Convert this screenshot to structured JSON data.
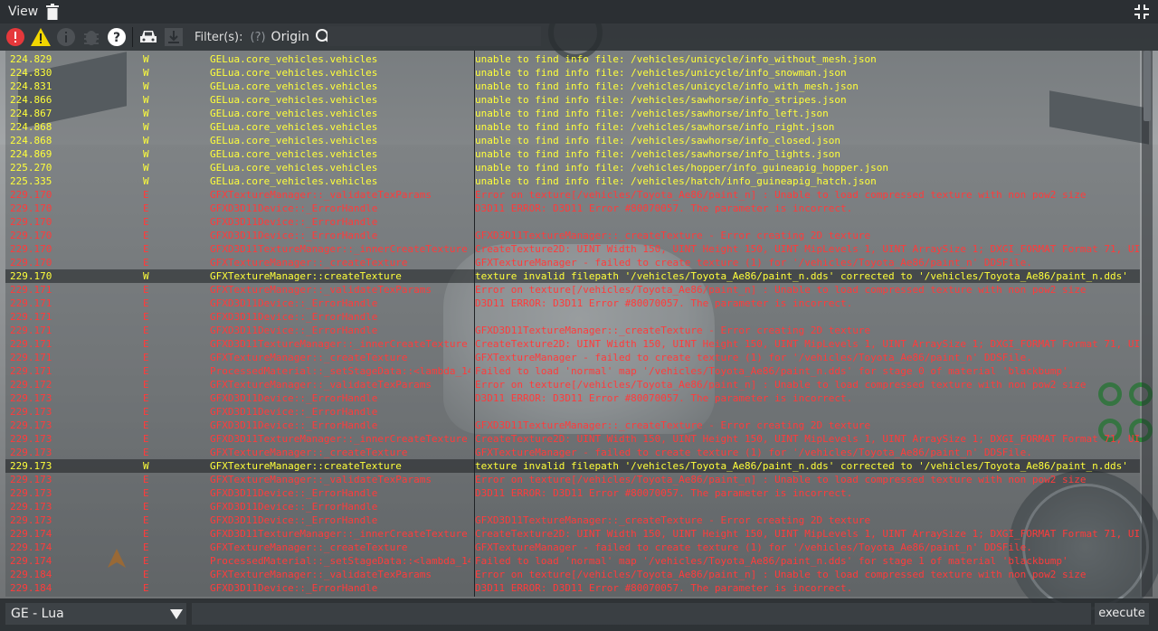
{
  "window": {
    "title": "View"
  },
  "toolbar": {
    "filter_label": "Filter(s):",
    "filter_help": "(?)",
    "origin_label": "Origin",
    "search_value": "",
    "colors": {
      "error": "#e5383b",
      "warning": "#f2d600",
      "help": "#ffffff"
    },
    "icons": [
      "error-filter-icon",
      "warning-filter-icon",
      "info-filter-icon",
      "debug-filter-icon",
      "help-icon",
      "vehicle-filter-icon",
      "download-icon"
    ]
  },
  "log": [
    {
      "time": "224.829",
      "level": "W",
      "origin": "GELua.core_vehicles.vehicles",
      "message": "unable to find info file: /vehicles/unicycle/info_without_mesh.json"
    },
    {
      "time": "224.830",
      "level": "W",
      "origin": "GELua.core_vehicles.vehicles",
      "message": "unable to find info file: /vehicles/unicycle/info_snowman.json"
    },
    {
      "time": "224.831",
      "level": "W",
      "origin": "GELua.core_vehicles.vehicles",
      "message": "unable to find info file: /vehicles/unicycle/info_with_mesh.json"
    },
    {
      "time": "224.866",
      "level": "W",
      "origin": "GELua.core_vehicles.vehicles",
      "message": "unable to find info file: /vehicles/sawhorse/info_stripes.json"
    },
    {
      "time": "224.867",
      "level": "W",
      "origin": "GELua.core_vehicles.vehicles",
      "message": "unable to find info file: /vehicles/sawhorse/info_left.json"
    },
    {
      "time": "224.868",
      "level": "W",
      "origin": "GELua.core_vehicles.vehicles",
      "message": "unable to find info file: /vehicles/sawhorse/info_right.json"
    },
    {
      "time": "224.868",
      "level": "W",
      "origin": "GELua.core_vehicles.vehicles",
      "message": "unable to find info file: /vehicles/sawhorse/info_closed.json"
    },
    {
      "time": "224.869",
      "level": "W",
      "origin": "GELua.core_vehicles.vehicles",
      "message": "unable to find info file: /vehicles/sawhorse/info_lights.json"
    },
    {
      "time": "225.270",
      "level": "W",
      "origin": "GELua.core_vehicles.vehicles",
      "message": "unable to find info file: /vehicles/hopper/info_guineapig_hopper.json"
    },
    {
      "time": "225.335",
      "level": "W",
      "origin": "GELua.core_vehicles.vehicles",
      "message": "unable to find info file: /vehicles/hatch/info_guineapig_hatch.json"
    },
    {
      "time": "229.170",
      "level": "E",
      "origin": "GFXTextureManager::_validateTexParams",
      "message": "Error on texture[/vehicles/Toyota_Ae86/paint_n] : Unable to load compressed texture with non pow2 size"
    },
    {
      "time": "229.170",
      "level": "E",
      "origin": "GFXD3D11Device::_ErrorHandle",
      "message": "D3D11 ERROR: D3D11 Error #80070057. The parameter is incorrect."
    },
    {
      "time": "229.170",
      "level": "E",
      "origin": "GFXD3D11Device::_ErrorHandle",
      "message": ""
    },
    {
      "time": "229.170",
      "level": "E",
      "origin": "GFXD3D11Device::_ErrorHandle",
      "message": "GFXD3D11TextureManager::_createTexture - Error creating 2D texture"
    },
    {
      "time": "229.170",
      "level": "E",
      "origin": "GFXD3D11TextureManager::_innerCreateTexture",
      "message": "CreateTexture2D: UINT Width 150, UINT Height 150, UINT MipLevels 1, UINT ArraySize 1; DXGI_FORMAT Format 71, UIN"
    },
    {
      "time": "229.170",
      "level": "E",
      "origin": "GFXTextureManager::_createTexture",
      "message": "GFXTextureManager - failed to create texture (1) for '/vehicles/Toyota_Ae86/paint_n' DDSFile."
    },
    {
      "time": "229.170",
      "level": "W",
      "origin": "GFXTextureManager::createTexture",
      "message": "texture invalid filepath '/vehicles/Toyota_Ae86/paint_n.dds' corrected to '/vehicles/Toyota_Ae86/paint_n.dds'"
    },
    {
      "time": "229.171",
      "level": "E",
      "origin": "GFXTextureManager::_validateTexParams",
      "message": "Error on texture[/vehicles/Toyota_Ae86/paint_n] : Unable to load compressed texture with non pow2 size"
    },
    {
      "time": "229.171",
      "level": "E",
      "origin": "GFXD3D11Device::_ErrorHandle",
      "message": "D3D11 ERROR: D3D11 Error #80070057. The parameter is incorrect."
    },
    {
      "time": "229.171",
      "level": "E",
      "origin": "GFXD3D11Device::_ErrorHandle",
      "message": ""
    },
    {
      "time": "229.171",
      "level": "E",
      "origin": "GFXD3D11Device::_ErrorHandle",
      "message": "GFXD3D11TextureManager::_createTexture - Error creating 2D texture"
    },
    {
      "time": "229.171",
      "level": "E",
      "origin": "GFXD3D11TextureManager::_innerCreateTexture",
      "message": "CreateTexture2D: UINT Width 150, UINT Height 150, UINT MipLevels 1, UINT ArraySize 1; DXGI_FORMAT Format 71, UIN"
    },
    {
      "time": "229.171",
      "level": "E",
      "origin": "GFXTextureManager::_createTexture",
      "message": "GFXTextureManager - failed to create texture (1) for '/vehicles/Toyota_Ae86/paint_n' DDSFile."
    },
    {
      "time": "229.171",
      "level": "E",
      "origin": "ProcessedMaterial::_setStageData::<lambda_14",
      "message": "Failed to load 'normal' map '/vehicles/Toyota_Ae86/paint_n.dds' for stage 0 of material 'blackbump'"
    },
    {
      "time": "229.172",
      "level": "E",
      "origin": "GFXTextureManager::_validateTexParams",
      "message": "Error on texture[/vehicles/Toyota_Ae86/paint_n] : Unable to load compressed texture with non pow2 size"
    },
    {
      "time": "229.173",
      "level": "E",
      "origin": "GFXD3D11Device::_ErrorHandle",
      "message": "D3D11 ERROR: D3D11 Error #80070057. The parameter is incorrect."
    },
    {
      "time": "229.173",
      "level": "E",
      "origin": "GFXD3D11Device::_ErrorHandle",
      "message": ""
    },
    {
      "time": "229.173",
      "level": "E",
      "origin": "GFXD3D11Device::_ErrorHandle",
      "message": "GFXD3D11TextureManager::_createTexture - Error creating 2D texture"
    },
    {
      "time": "229.173",
      "level": "E",
      "origin": "GFXD3D11TextureManager::_innerCreateTexture",
      "message": "CreateTexture2D: UINT Width 150, UINT Height 150, UINT MipLevels 1, UINT ArraySize 1; DXGI_FORMAT Format 71, UIN"
    },
    {
      "time": "229.173",
      "level": "E",
      "origin": "GFXTextureManager::_createTexture",
      "message": "GFXTextureManager - failed to create texture (1) for '/vehicles/Toyota_Ae86/paint_n' DDSFile."
    },
    {
      "time": "229.173",
      "level": "W",
      "origin": "GFXTextureManager::createTexture",
      "message": "texture invalid filepath '/vehicles/Toyota_Ae86/paint_n.dds' corrected to '/vehicles/Toyota_Ae86/paint_n.dds'"
    },
    {
      "time": "229.173",
      "level": "E",
      "origin": "GFXTextureManager::_validateTexParams",
      "message": "Error on texture[/vehicles/Toyota_Ae86/paint_n] : Unable to load compressed texture with non pow2 size"
    },
    {
      "time": "229.173",
      "level": "E",
      "origin": "GFXD3D11Device::_ErrorHandle",
      "message": "D3D11 ERROR: D3D11 Error #80070057. The parameter is incorrect."
    },
    {
      "time": "229.173",
      "level": "E",
      "origin": "GFXD3D11Device::_ErrorHandle",
      "message": ""
    },
    {
      "time": "229.173",
      "level": "E",
      "origin": "GFXD3D11Device::_ErrorHandle",
      "message": "GFXD3D11TextureManager::_createTexture - Error creating 2D texture"
    },
    {
      "time": "229.174",
      "level": "E",
      "origin": "GFXD3D11TextureManager::_innerCreateTexture",
      "message": "CreateTexture2D: UINT Width 150, UINT Height 150, UINT MipLevels 1, UINT ArraySize 1; DXGI_FORMAT Format 71, UIN"
    },
    {
      "time": "229.174",
      "level": "E",
      "origin": "GFXTextureManager::_createTexture",
      "message": "GFXTextureManager - failed to create texture (1) for '/vehicles/Toyota_Ae86/paint_n' DDSFile."
    },
    {
      "time": "229.174",
      "level": "E",
      "origin": "ProcessedMaterial::_setStageData::<lambda_14",
      "message": "Failed to load 'normal' map '/vehicles/Toyota_Ae86/paint_n.dds' for stage 1 of material 'blackbump'"
    },
    {
      "time": "229.184",
      "level": "E",
      "origin": "GFXTextureManager::_validateTexParams",
      "message": "Error on texture[/vehicles/Toyota_Ae86/paint_n] : Unable to load compressed texture with non pow2 size"
    },
    {
      "time": "229.184",
      "level": "E",
      "origin": "GFXD3D11Device::_ErrorHandle",
      "message": "D3D11 ERROR: D3D11 Error #80070057. The parameter is incorrect."
    }
  ],
  "bottom": {
    "context_select": "GE - Lua",
    "command_value": "",
    "execute_label": "execute"
  }
}
